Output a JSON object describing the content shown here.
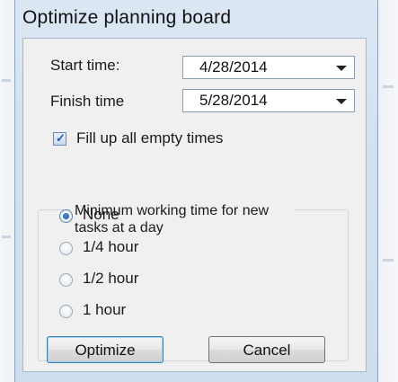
{
  "window": {
    "title": "Optimize planning board"
  },
  "start_time": {
    "label": "Start time:",
    "value": "4/28/2014"
  },
  "finish_time": {
    "label": "Finish time",
    "value": "5/28/2014"
  },
  "fill_empty": {
    "label": "Fill up all empty times",
    "checked": true
  },
  "min_working_time": {
    "legend": "Minimum working time for new tasks at a day",
    "options": [
      {
        "label": "None",
        "selected": true
      },
      {
        "label": "1/4 hour",
        "selected": false
      },
      {
        "label": "1/2 hour",
        "selected": false
      },
      {
        "label": "1 hour",
        "selected": false
      }
    ]
  },
  "buttons": {
    "optimize": "Optimize",
    "cancel": "Cancel"
  },
  "icons": {
    "dropdown": "chevron-down-icon",
    "check": "checkmark-icon"
  },
  "colors": {
    "client_bg": "#f0f0f0",
    "frame": "#d2e1f0",
    "radio_selected": "#1d4f9a",
    "default_button_border": "#3c7fb1"
  }
}
